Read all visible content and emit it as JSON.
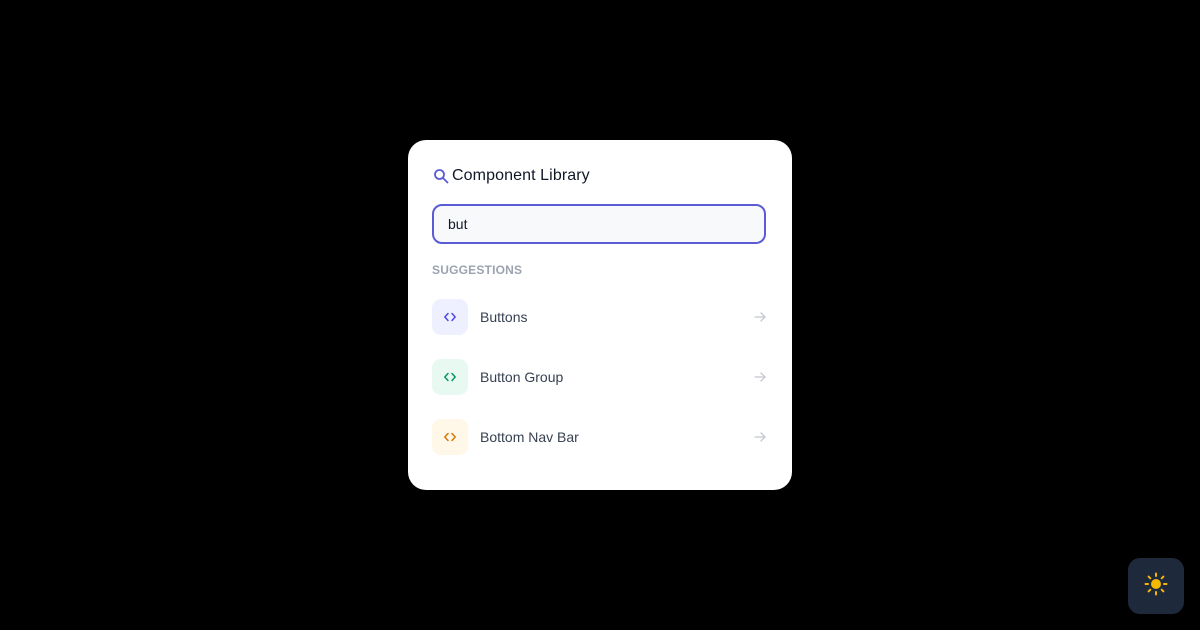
{
  "panel": {
    "title": "Component Library",
    "title_icon": "search-icon",
    "accent_color": "#5b5bd6"
  },
  "search": {
    "value": "but",
    "placeholder": ""
  },
  "suggestions": {
    "heading": "SUGGESTIONS",
    "items": [
      {
        "label": "Buttons",
        "icon": "code-icon",
        "glyph": "<>",
        "icon_color": "#4f46e5",
        "icon_bg": "#eef0ff"
      },
      {
        "label": "Button Group",
        "icon": "code-icon",
        "glyph": "<>",
        "icon_color": "#059669",
        "icon_bg": "#e8f9f1"
      },
      {
        "label": "Bottom Nav Bar",
        "icon": "code-icon",
        "glyph": "<>",
        "icon_color": "#d97706",
        "icon_bg": "#fff7e8"
      }
    ]
  },
  "theme_toggle": {
    "icon": "sun-icon",
    "icon_color": "#f5b800",
    "bg_color": "#1e293b"
  }
}
